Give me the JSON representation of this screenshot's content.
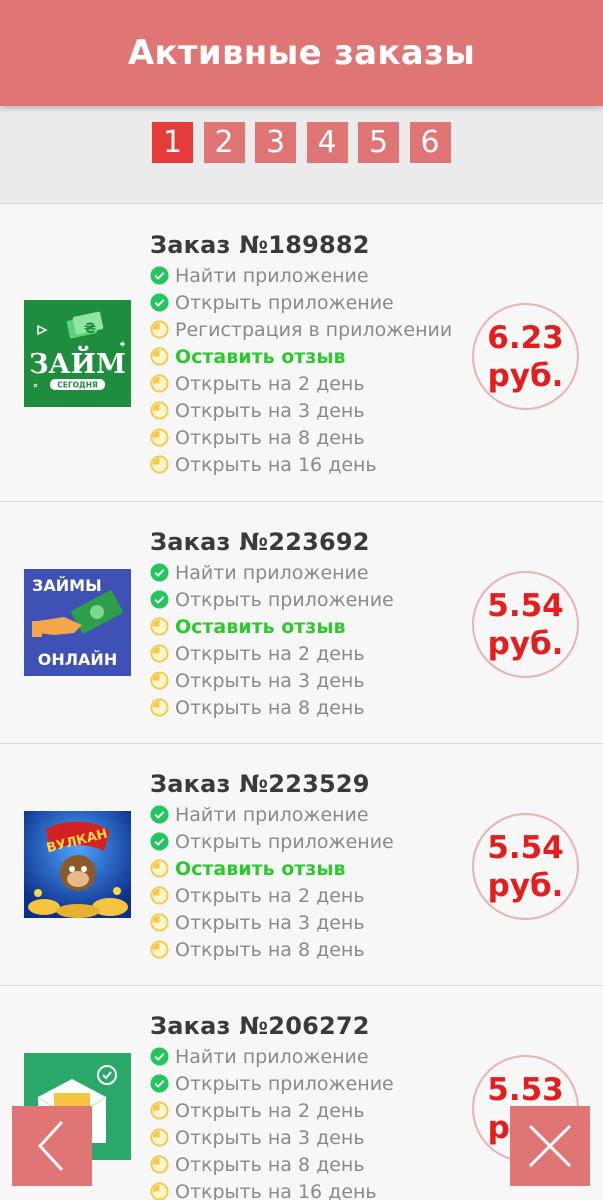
{
  "header": {
    "title": "Активные заказы"
  },
  "pagination": {
    "pages": [
      "1",
      "2",
      "3",
      "4",
      "5",
      "6"
    ],
    "active": "1"
  },
  "orders": [
    {
      "title": "Заказ №189882",
      "app_icon": "zaim-segodnya-icon",
      "icon_text": {
        "main": "ЗАЙМ",
        "sub": "СЕГОДНЯ"
      },
      "steps": [
        {
          "label": "Найти приложение",
          "status": "done"
        },
        {
          "label": "Открыть приложение",
          "status": "done"
        },
        {
          "label": "Регистрация в приложении",
          "status": "pending"
        },
        {
          "label": "Оставить отзыв",
          "status": "current"
        },
        {
          "label": "Открыть на 2 день",
          "status": "pending"
        },
        {
          "label": "Открыть на 3 день",
          "status": "pending"
        },
        {
          "label": "Открыть на 8 день",
          "status": "pending"
        },
        {
          "label": "Открыть на 16 день",
          "status": "pending"
        }
      ],
      "price_value": "6.23",
      "price_unit": "руб."
    },
    {
      "title": "Заказ №223692",
      "app_icon": "zaimy-online-icon",
      "icon_text": {
        "top": "ЗАЙМЫ",
        "bottom": "ОНЛАЙН"
      },
      "steps": [
        {
          "label": "Найти приложение",
          "status": "done"
        },
        {
          "label": "Открыть приложение",
          "status": "done"
        },
        {
          "label": "Оставить отзыв",
          "status": "current"
        },
        {
          "label": "Открыть на 2 день",
          "status": "pending"
        },
        {
          "label": "Открыть на 3 день",
          "status": "pending"
        },
        {
          "label": "Открыть на 8 день",
          "status": "pending"
        }
      ],
      "price_value": "5.54",
      "price_unit": "руб."
    },
    {
      "title": "Заказ №223529",
      "app_icon": "vulkan-slots-icon",
      "icon_text": {
        "logo": "ВУЛКАН"
      },
      "steps": [
        {
          "label": "Найти приложение",
          "status": "done"
        },
        {
          "label": "Открыть приложение",
          "status": "done"
        },
        {
          "label": "Оставить отзыв",
          "status": "current"
        },
        {
          "label": "Открыть на 2 день",
          "status": "pending"
        },
        {
          "label": "Открыть на 3 день",
          "status": "pending"
        },
        {
          "label": "Открыть на 8 день",
          "status": "pending"
        }
      ],
      "price_value": "5.54",
      "price_unit": "руб."
    },
    {
      "title": "Заказ №206272",
      "app_icon": "money-envelope-icon",
      "steps": [
        {
          "label": "Найти приложение",
          "status": "done"
        },
        {
          "label": "Открыть приложение",
          "status": "done"
        },
        {
          "label": "Открыть на 2 день",
          "status": "pending"
        },
        {
          "label": "Открыть на 3 день",
          "status": "pending"
        },
        {
          "label": "Открыть на 8 день",
          "status": "pending"
        },
        {
          "label": "Открыть на 16 день",
          "status": "pending"
        }
      ],
      "price_value": "5.53",
      "price_unit": "руб."
    }
  ],
  "nav": {
    "back_icon": "chevron-left-icon",
    "close_icon": "close-icon"
  },
  "colors": {
    "accent": "#e07575",
    "active_page": "#e53b3b",
    "price": "#e31e1e",
    "done": "#22c55e",
    "pending": "#f2c94c",
    "current_text": "#2ec82e"
  }
}
